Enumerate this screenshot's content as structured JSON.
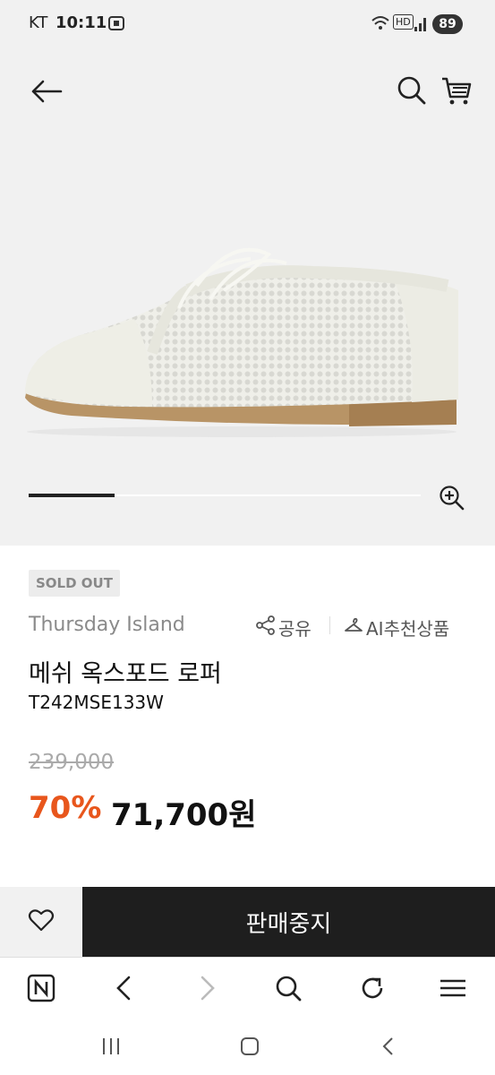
{
  "status_bar": {
    "carrier": "KT",
    "time": "10:11",
    "network_label": "HD",
    "battery": "89"
  },
  "product": {
    "status_badge": "SOLD OUT",
    "brand": "Thursday Island",
    "share_label": "공유",
    "ai_label": "AI추천상품",
    "name": "메쉬 옥스포드 로퍼",
    "code": "T242MSE133W",
    "original_price": "239,000",
    "discount": "70%",
    "sale_price": "71,700원",
    "image_progress": 0.22
  },
  "actions": {
    "stop_label": "판매중지"
  },
  "colors": {
    "discount": "#e8561c",
    "primary_button": "#1e1e1e",
    "hero_bg": "#f1f1f1"
  },
  "icons": {
    "back": "back-arrow-icon",
    "search": "search-icon",
    "cart": "cart-icon",
    "zoom": "zoom-in-icon",
    "share": "share-icon",
    "ai": "hanger-icon",
    "wishlist": "heart-icon"
  }
}
